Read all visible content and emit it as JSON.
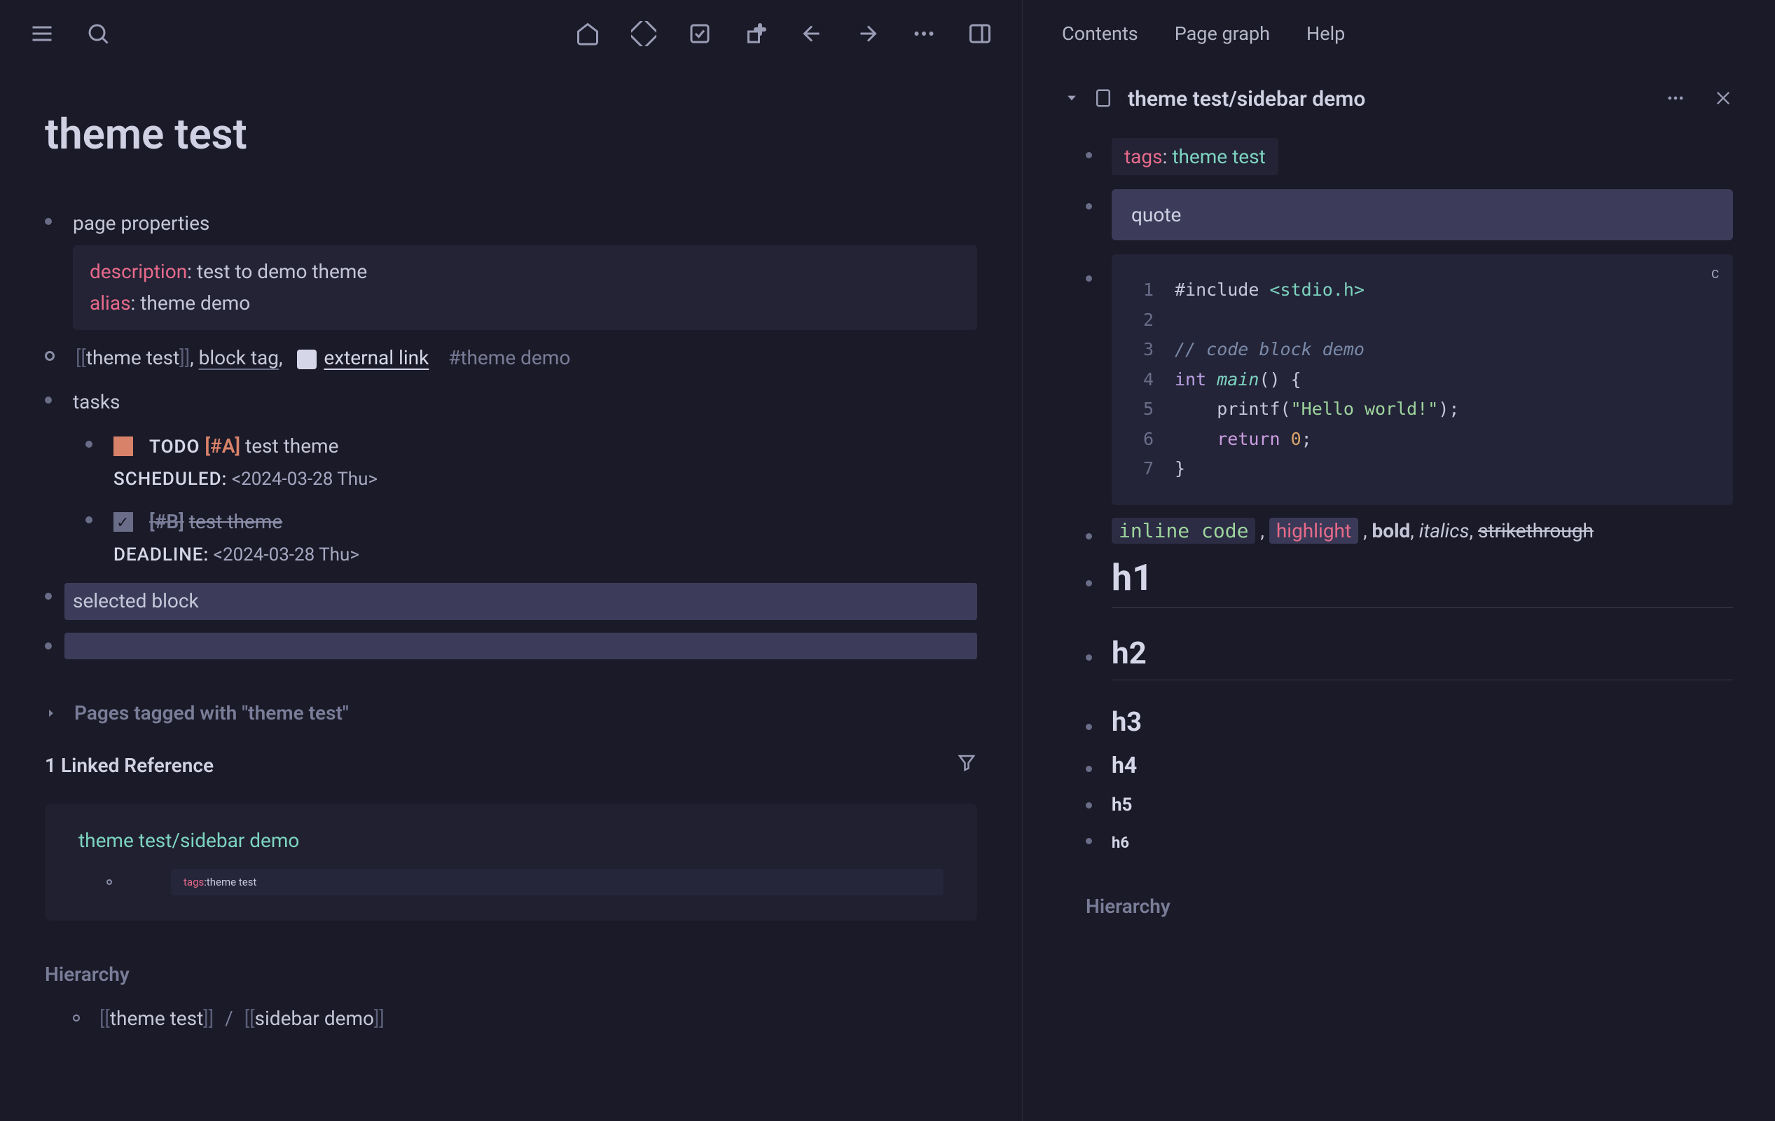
{
  "topbar": {
    "icons": [
      "menu",
      "search",
      "home",
      "graph",
      "flashcard",
      "plugin",
      "back",
      "forward",
      "more",
      "sidebar"
    ]
  },
  "rs_topbar": {
    "items": [
      "Contents",
      "Page graph",
      "Help"
    ]
  },
  "page": {
    "title": "theme test",
    "properties_label": "page properties",
    "properties": {
      "description_key": "description",
      "description_val": "test to demo theme",
      "alias_key": "alias",
      "alias_val": "theme demo"
    },
    "link_line": {
      "page_ref": "theme test",
      "block_tag": "block tag",
      "external": "external link",
      "hash": "#theme demo"
    },
    "tasks_label": "tasks",
    "task1": {
      "todo": "TODO",
      "priority": "[#A]",
      "text": "test theme",
      "sched_label": "SCHEDULED:",
      "sched_date": "<2024-03-28 Thu>"
    },
    "task2": {
      "priority": "[#B]",
      "text": "test theme",
      "dead_label": "DEADLINE:",
      "dead_date": "<2024-03-28 Thu>"
    },
    "selected": "selected block",
    "tagged_section": "Pages tagged with \"theme test\"",
    "linked_ref": "1 Linked Reference",
    "ref_title": "theme test/sidebar demo",
    "ref_tags_key": "tags",
    "ref_tags_val": "theme test",
    "hierarchy": "Hierarchy",
    "hier_item1": "theme test",
    "hier_item2": "sidebar demo"
  },
  "rs": {
    "title": "theme test/sidebar demo",
    "tags_key": "tags",
    "tags_val": "theme test",
    "quote": "quote",
    "code_lang": "c",
    "code": {
      "l1_a": "#include",
      "l1_b": "<stdio.h>",
      "l2": "",
      "l3": "// code block demo",
      "l4_a": "int",
      "l4_b": "main",
      "l4_c": "() {",
      "l5_a": "printf",
      "l5_b": "(",
      "l5_c": "\"Hello world!\"",
      "l5_d": ");",
      "l6_a": "return",
      "l6_b": "0",
      "l6_c": ";",
      "l7": "}"
    },
    "inline": {
      "code": "inline code",
      "highlight": "highlight",
      "bold": "bold",
      "italics": "italics",
      "strike": "strikethrough"
    },
    "h1": "h1",
    "h2": "h2",
    "h3": "h3",
    "h4": "h4",
    "h5": "h5",
    "h6": "h6",
    "hierarchy": "Hierarchy"
  }
}
